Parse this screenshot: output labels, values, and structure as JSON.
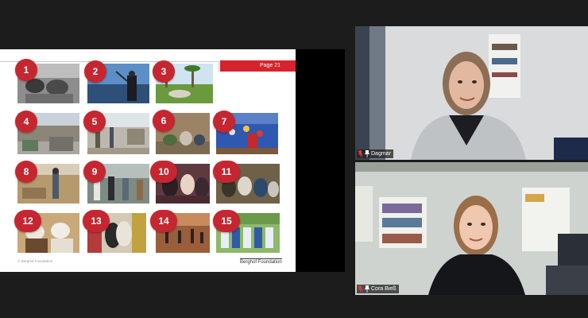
{
  "slide": {
    "page_label": "Page 21",
    "footer_copyright": "© Berghof Foundation",
    "footer_logo_text": "Berghof Foundation",
    "photos": [
      {
        "number": "1"
      },
      {
        "number": "2"
      },
      {
        "number": "3"
      },
      {
        "number": "4"
      },
      {
        "number": "5"
      },
      {
        "number": "6"
      },
      {
        "number": "7"
      },
      {
        "number": "8"
      },
      {
        "number": "9"
      },
      {
        "number": "10"
      },
      {
        "number": "11"
      },
      {
        "number": "12"
      },
      {
        "number": "13"
      },
      {
        "number": "14"
      },
      {
        "number": "15"
      }
    ]
  },
  "participants": [
    {
      "name": "Dagmar",
      "mic_icon": "muted-mic-icon",
      "pin_icon": "pin-icon"
    },
    {
      "name": "Cora Bieß",
      "mic_icon": "muted-mic-icon",
      "pin_icon": "pin-icon"
    }
  ],
  "colors": {
    "accent_red": "#c62630",
    "background": "#1c1c1c"
  }
}
